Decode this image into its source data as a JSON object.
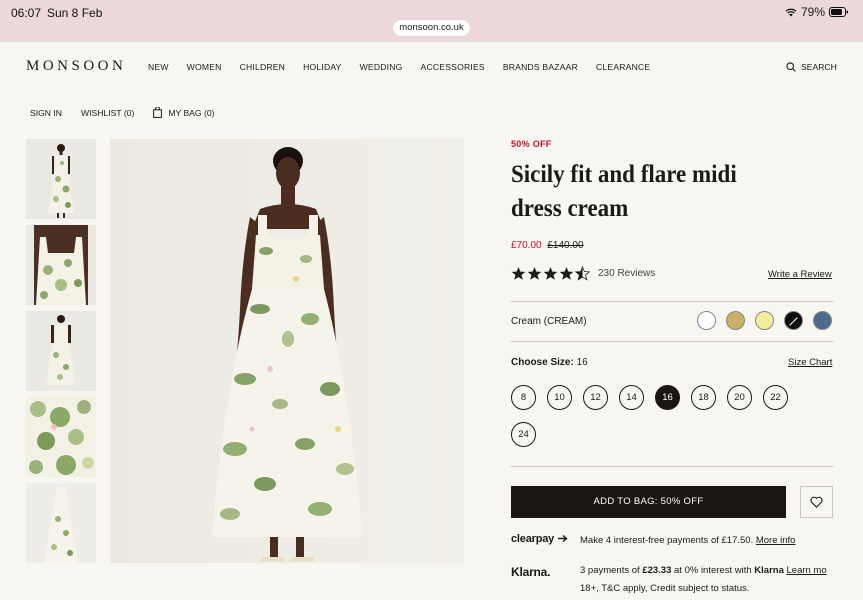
{
  "status_bar": {
    "time": "06:07",
    "date": "Sun 8 Feb",
    "battery": "79%",
    "url": "monsoon.co.uk"
  },
  "header": {
    "logo": "MONSOON",
    "nav": [
      "NEW",
      "WOMEN",
      "CHILDREN",
      "HOLIDAY",
      "WEDDING",
      "ACCESSORIES",
      "BRANDS BAZAAR",
      "CLEARANCE"
    ],
    "search_label": "SEARCH",
    "sign_in": "SIGN IN",
    "wishlist": "WISHLIST (0)",
    "bag": "MY BAG (0)"
  },
  "product": {
    "badge": "50% OFF",
    "title": "Sicily fit and flare midi dress cream",
    "price_now": "£70.00",
    "price_was": "£140.00",
    "rating": 4.5,
    "reviews": "230 Reviews",
    "write_review": "Write a Review",
    "colour_label": "Cream (CREAM)",
    "swatches": [
      {
        "color": "#ffffff",
        "selected": false
      },
      {
        "color": "#c8b066",
        "selected": false
      },
      {
        "color": "#f3ee9a",
        "selected": false
      },
      {
        "color": "#0d0d0d",
        "selected": true
      },
      {
        "color": "#4d6a8c",
        "selected": false
      }
    ],
    "size_label": "Choose Size:",
    "size_value": "16",
    "size_chart": "Size Chart",
    "sizes": [
      "8",
      "10",
      "12",
      "14",
      "16",
      "18",
      "20",
      "22",
      "24"
    ],
    "selected_size": "16",
    "add_to_bag": "ADD TO BAG: 50% OFF"
  },
  "payments": {
    "clearpay_logo": "clearpay",
    "clearpay_text": "Make 4 interest-free payments of £17.50.",
    "clearpay_link": "More info",
    "klarna_logo": "Klarna.",
    "klarna_prefix": "3 payments of",
    "klarna_amount": "£23.33",
    "klarna_middle": "at 0% interest with",
    "klarna_brand": "Klarna",
    "klarna_link": "Learn mo",
    "klarna_line2": "18+, T&C apply, Credit subject to status."
  }
}
